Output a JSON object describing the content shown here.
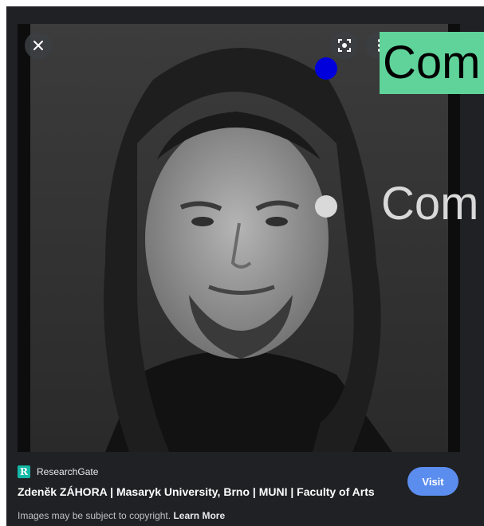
{
  "viewer": {
    "close_icon": "close-icon",
    "lens_icon": "lens-search-icon",
    "more_icon": "more-vert-icon"
  },
  "source": {
    "logo_text": "R",
    "name": "ResearchGate"
  },
  "result": {
    "title": "Zdeněk ZÁHORA | Masaryk University, Brno | MUNI | Faculty of Arts",
    "visit_label": "Visit"
  },
  "footer": {
    "copyright_text": "Images may be subject to copyright.",
    "learn_more": "Learn More"
  },
  "overlays": {
    "label_1": "Com",
    "label_2": "Com",
    "accent_green": "#5fd39a",
    "accent_blue": "#0000dd"
  }
}
